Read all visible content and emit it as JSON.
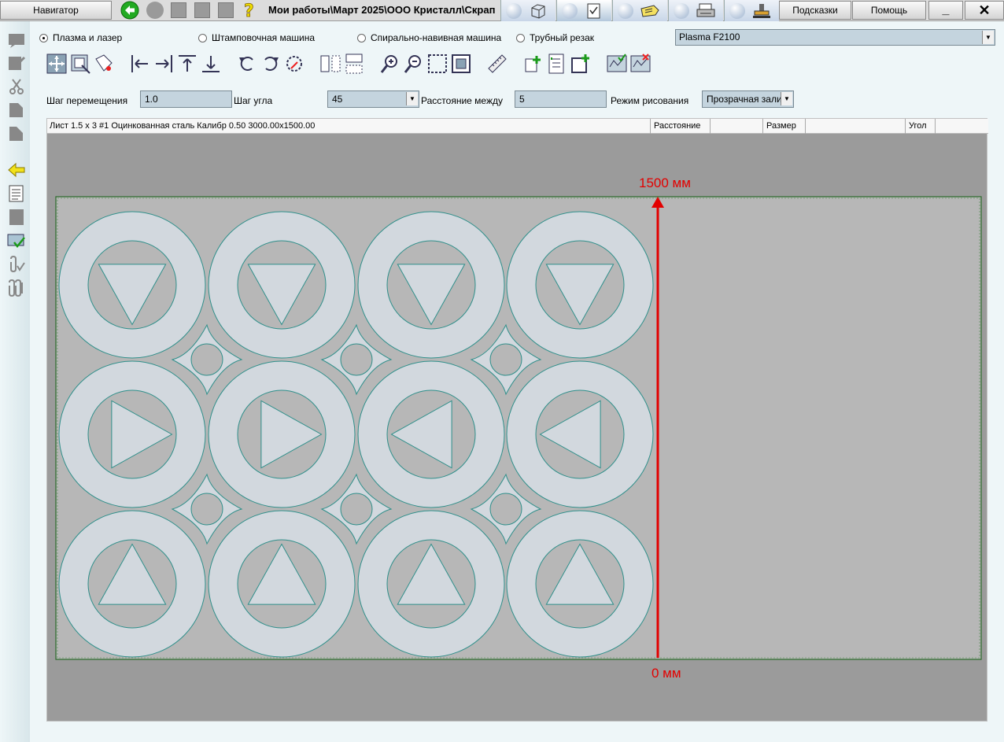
{
  "titlebar": {
    "navigator_label": "Навигатор",
    "path": "Мои работы\\Март 2025\\ООО Кристалл\\Скрап",
    "hints_label": "Подсказки",
    "help_label": "Помощь",
    "minimize_glyph": "_",
    "close_glyph": "✕"
  },
  "machine_types": [
    {
      "label": "Плазма и лазер",
      "selected": true
    },
    {
      "label": "Штамповочная машина",
      "selected": false
    },
    {
      "label": "Спирально-навивная машина",
      "selected": false
    },
    {
      "label": "Трубный резак",
      "selected": false
    }
  ],
  "machine_select": {
    "value": "Plasma F2100"
  },
  "params": {
    "move_step_label": "Шаг перемещения",
    "move_step_value": "1.0",
    "angle_step_label": "Шаг угла",
    "angle_step_value": "45",
    "distance_label": "Расстояние между",
    "distance_value": "5",
    "draw_mode_label": "Режим рисования",
    "draw_mode_value": "Прозрачная зали"
  },
  "info_bar": {
    "sheet_desc": "Лист 1.5 x 3 #1 Оцинкованная сталь Калибр 0.50 3000.00x1500.00",
    "distance_label": "Расстояние",
    "size_label": "Размер",
    "angle_label": "Угол"
  },
  "annotations": {
    "top_label": "1500 мм",
    "bottom_label": "0 мм"
  },
  "colors": {
    "part_outline": "#2f8f8a",
    "part_fill": "#d2d8de",
    "sheet_fill": "#b7b7b7",
    "annotation_red": "#e30000"
  },
  "nest": {
    "triangle_rows": [
      "down",
      "right-left",
      "up"
    ],
    "columns": 4
  }
}
